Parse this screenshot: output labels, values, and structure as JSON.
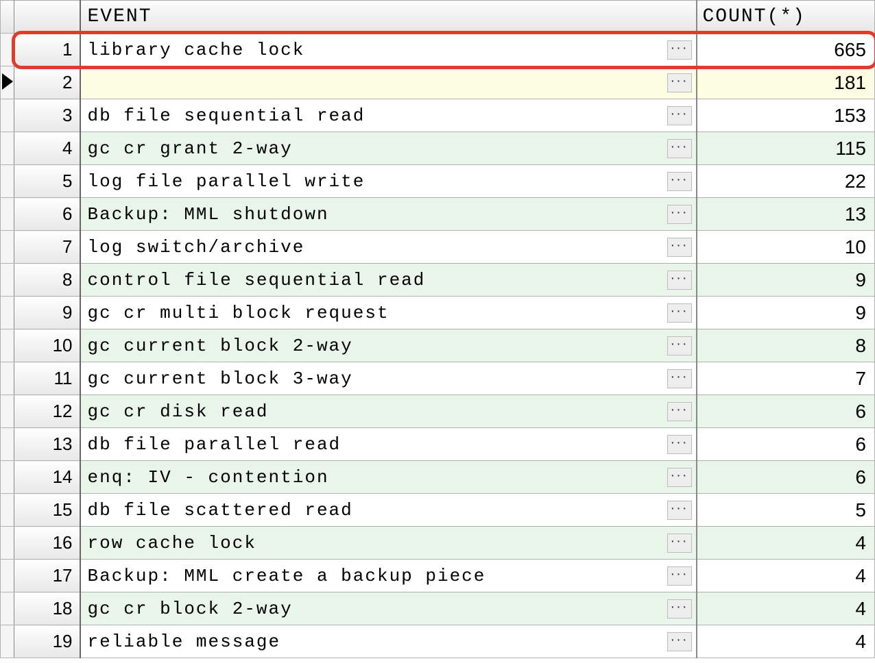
{
  "columns": {
    "event_header": "EVENT",
    "count_header": "COUNT(*)"
  },
  "ellipsis_label": "···",
  "highlight_row_index": 0,
  "active_row_index": 1,
  "rows": [
    {
      "num": "1",
      "event": "library cache lock",
      "count": "665"
    },
    {
      "num": "2",
      "event": "",
      "count": "181"
    },
    {
      "num": "3",
      "event": "db file sequential read",
      "count": "153"
    },
    {
      "num": "4",
      "event": "gc cr grant 2-way",
      "count": "115"
    },
    {
      "num": "5",
      "event": "log file parallel write",
      "count": "22"
    },
    {
      "num": "6",
      "event": "Backup: MML shutdown",
      "count": "13"
    },
    {
      "num": "7",
      "event": "log switch/archive",
      "count": "10"
    },
    {
      "num": "8",
      "event": "control file sequential read",
      "count": "9"
    },
    {
      "num": "9",
      "event": "gc cr multi block request",
      "count": "9"
    },
    {
      "num": "10",
      "event": "gc current block 2-way",
      "count": "8"
    },
    {
      "num": "11",
      "event": "gc current block 3-way",
      "count": "7"
    },
    {
      "num": "12",
      "event": "gc cr disk read",
      "count": "6"
    },
    {
      "num": "13",
      "event": "db file parallel read",
      "count": "6"
    },
    {
      "num": "14",
      "event": "enq: IV -  contention",
      "count": "6"
    },
    {
      "num": "15",
      "event": "db file scattered read",
      "count": "5"
    },
    {
      "num": "16",
      "event": "row cache lock",
      "count": "4"
    },
    {
      "num": "17",
      "event": "Backup: MML create a backup piece",
      "count": "4"
    },
    {
      "num": "18",
      "event": "gc cr block 2-way",
      "count": "4"
    },
    {
      "num": "19",
      "event": "reliable message",
      "count": "4"
    }
  ]
}
